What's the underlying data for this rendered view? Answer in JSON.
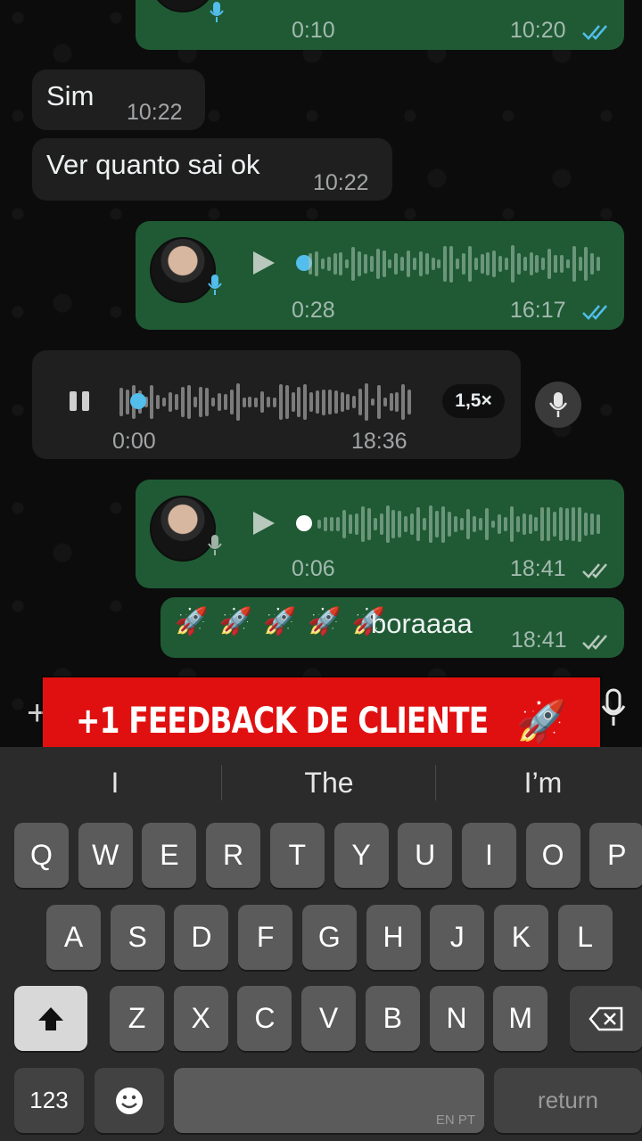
{
  "messages": {
    "top_voice": {
      "duration": "0:10",
      "time": "10:20"
    },
    "msg1": {
      "text": "Sim",
      "time": "10:22"
    },
    "msg2": {
      "text": "Ver quanto sai ok",
      "time": "10:22"
    },
    "voice2": {
      "duration": "0:28",
      "time": "16:17"
    },
    "voice_in": {
      "position": "0:00",
      "time": "18:36",
      "speed": "1,5×"
    },
    "voice3": {
      "duration": "0:06",
      "time": "18:41"
    },
    "msg3": {
      "emoji": "🚀 🚀 🚀 🚀 🚀",
      "text": "boraaaa",
      "time": "18:41"
    }
  },
  "overlay": {
    "banner_text": "+1 FEEDBACK DE CLIENTE",
    "banner_emoji": "🚀"
  },
  "keyboard": {
    "suggestions": [
      "I",
      "The",
      "I’m"
    ],
    "row1": [
      "Q",
      "W",
      "E",
      "R",
      "T",
      "Y",
      "U",
      "I",
      "O",
      "P"
    ],
    "row2": [
      "A",
      "S",
      "D",
      "F",
      "G",
      "H",
      "J",
      "K",
      "L"
    ],
    "row3": [
      "Z",
      "X",
      "C",
      "V",
      "B",
      "N",
      "M"
    ],
    "numbers_label": "123",
    "return_label": "return",
    "space_lang": "EN PT"
  },
  "colors": {
    "outgoing_bubble": "#1f5a34",
    "incoming_bubble": "#1f1f1f",
    "read_tick": "#53bdeb",
    "banner": "#e01010"
  }
}
